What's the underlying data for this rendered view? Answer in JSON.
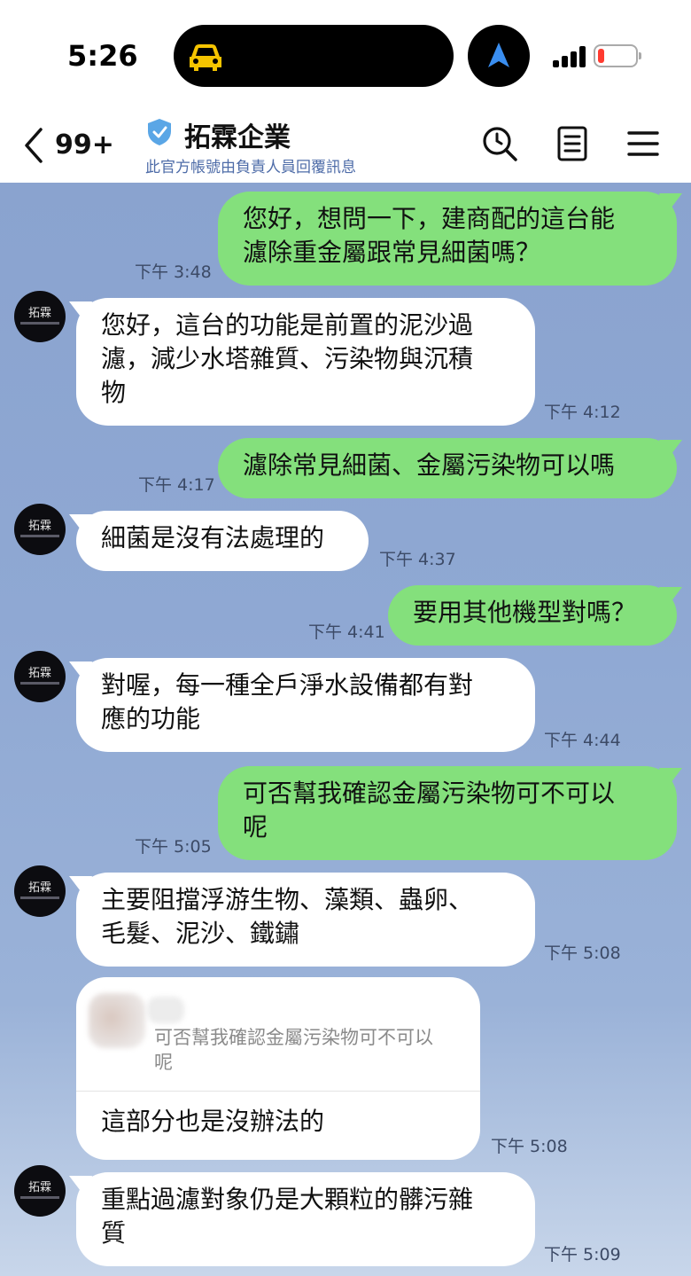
{
  "status_bar": {
    "time": "5:26"
  },
  "header": {
    "back_count": "99+",
    "title": "拓霖企業",
    "subtitle": "此官方帳號由負責人員回覆訊息"
  },
  "avatar": {
    "label": "拓霖"
  },
  "colors": {
    "outgoing": "#84e07c",
    "incoming": "#ffffff",
    "chat_bg": "#8fa8d3",
    "subtitle": "#4e6ca8"
  },
  "messages": [
    {
      "dir": "out",
      "text": "您好，想問一下，建商配的這台能\n濾除重金屬跟常見細菌嗎？",
      "time": "下午 3:48"
    },
    {
      "dir": "in",
      "text": "您好，這台的功能是前置的泥沙過\n濾，減少水塔雜質、污染物與沉積\n物",
      "time": "下午 4:12"
    },
    {
      "dir": "out",
      "text": "濾除常見細菌、金屬污染物可以嗎",
      "time": "下午 4:17"
    },
    {
      "dir": "in",
      "text": "細菌是沒有法處理的",
      "time": "下午 4:37"
    },
    {
      "dir": "out",
      "text": "要用其他機型對嗎？",
      "time": "下午 4:41"
    },
    {
      "dir": "in",
      "text": "對喔，每一種全戶淨水設備都有對\n應的功能",
      "time": "下午 4:44"
    },
    {
      "dir": "out",
      "text": "可否幫我確認金屬污染物可不可以\n呢",
      "time": "下午 5:05"
    },
    {
      "dir": "in",
      "text": "主要阻擋浮游生物、藻類、蟲卵、\n毛髮、泥沙、鐵鏽",
      "time": "下午 5:08"
    },
    {
      "dir": "in",
      "reply_quote": "可否幫我確認金屬污染物可不可以\n呢",
      "text": "這部分也是沒辦法的",
      "time": "下午 5:08"
    },
    {
      "dir": "in",
      "text": "重點過濾對象仍是大顆粒的髒污雜\n質",
      "time": "下午 5:09"
    }
  ]
}
